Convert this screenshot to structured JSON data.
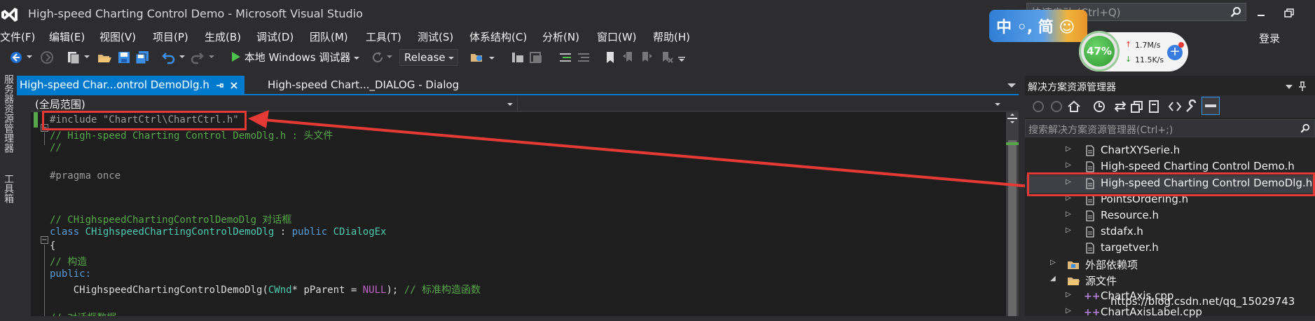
{
  "window": {
    "title": "High-speed Charting Control Demo - Microsoft Visual Studio",
    "quick_launch_placeholder": "快速启动 (Ctrl+Q)",
    "login_label": "登录"
  },
  "menu": [
    "文件(F)",
    "编辑(E)",
    "视图(V)",
    "项目(P)",
    "生成(B)",
    "调试(D)",
    "团队(M)",
    "工具(T)",
    "测试(S)",
    "体系结构(C)",
    "分析(N)",
    "窗口(W)",
    "帮助(H)"
  ],
  "toolbar": {
    "run_label": "本地 Windows 调试器",
    "configuration": "Release"
  },
  "tabs": {
    "active": "High-speed Char...ontrol DemoDlg.h",
    "inactive": "High-speed Chart..._DIALOG - Dialog"
  },
  "side_strip": {
    "server_explorer": "服务器资源管理器",
    "toolbox": "工具箱"
  },
  "editor": {
    "scope": "(全局范围)",
    "lines": [
      "#include \"ChartCtrl\\ChartCtrl.h\"",
      "// High-speed Charting Control DemoDlg.h : 头文件",
      "//",
      "",
      "#pragma once",
      "",
      "",
      "// CHighspeedChartingControlDemoDlg 对话框",
      "class CHighspeedChartingControlDemoDlg : public CDialogEx",
      "{",
      "// 构造",
      "public:",
      "    CHighspeedChartingControlDemoDlg(CWnd* pParent = NULL); // 标准构造函数",
      "",
      "// 对话框数据"
    ]
  },
  "solution_explorer": {
    "title": "解决方案资源管理器",
    "search_placeholder": "搜索解决方案资源管理器(Ctrl+;)",
    "items": [
      {
        "label": "ChartXYSerie.h",
        "kind": "header"
      },
      {
        "label": "High-speed Charting Control Demo.h",
        "kind": "header"
      },
      {
        "label": "High-speed Charting Control DemoDlg.h",
        "kind": "header",
        "selected": true
      },
      {
        "label": "PointsOrdering.h",
        "kind": "header"
      },
      {
        "label": "Resource.h",
        "kind": "header"
      },
      {
        "label": "stdafx.h",
        "kind": "header"
      },
      {
        "label": "targetver.h",
        "kind": "header"
      },
      {
        "label": "外部依赖项",
        "kind": "folder"
      },
      {
        "label": "源文件",
        "kind": "folder"
      },
      {
        "label": "ChartAxis.cpp",
        "kind": "cpp"
      },
      {
        "label": "ChartAxisLabel.cpp",
        "kind": "cpp"
      }
    ]
  },
  "overlays": {
    "ime_text": "中 ◦, 简 ☺",
    "cpu_percent": "47%",
    "upload_speed": "1.7M/s",
    "download_speed": "11.5K/s",
    "watermark": "https://blog.csdn.net/qq_15029743"
  },
  "colors": {
    "accent": "#007acc",
    "annotation": "#e53935",
    "background": "#2d2d30",
    "editor_background": "#1e1e1e"
  }
}
